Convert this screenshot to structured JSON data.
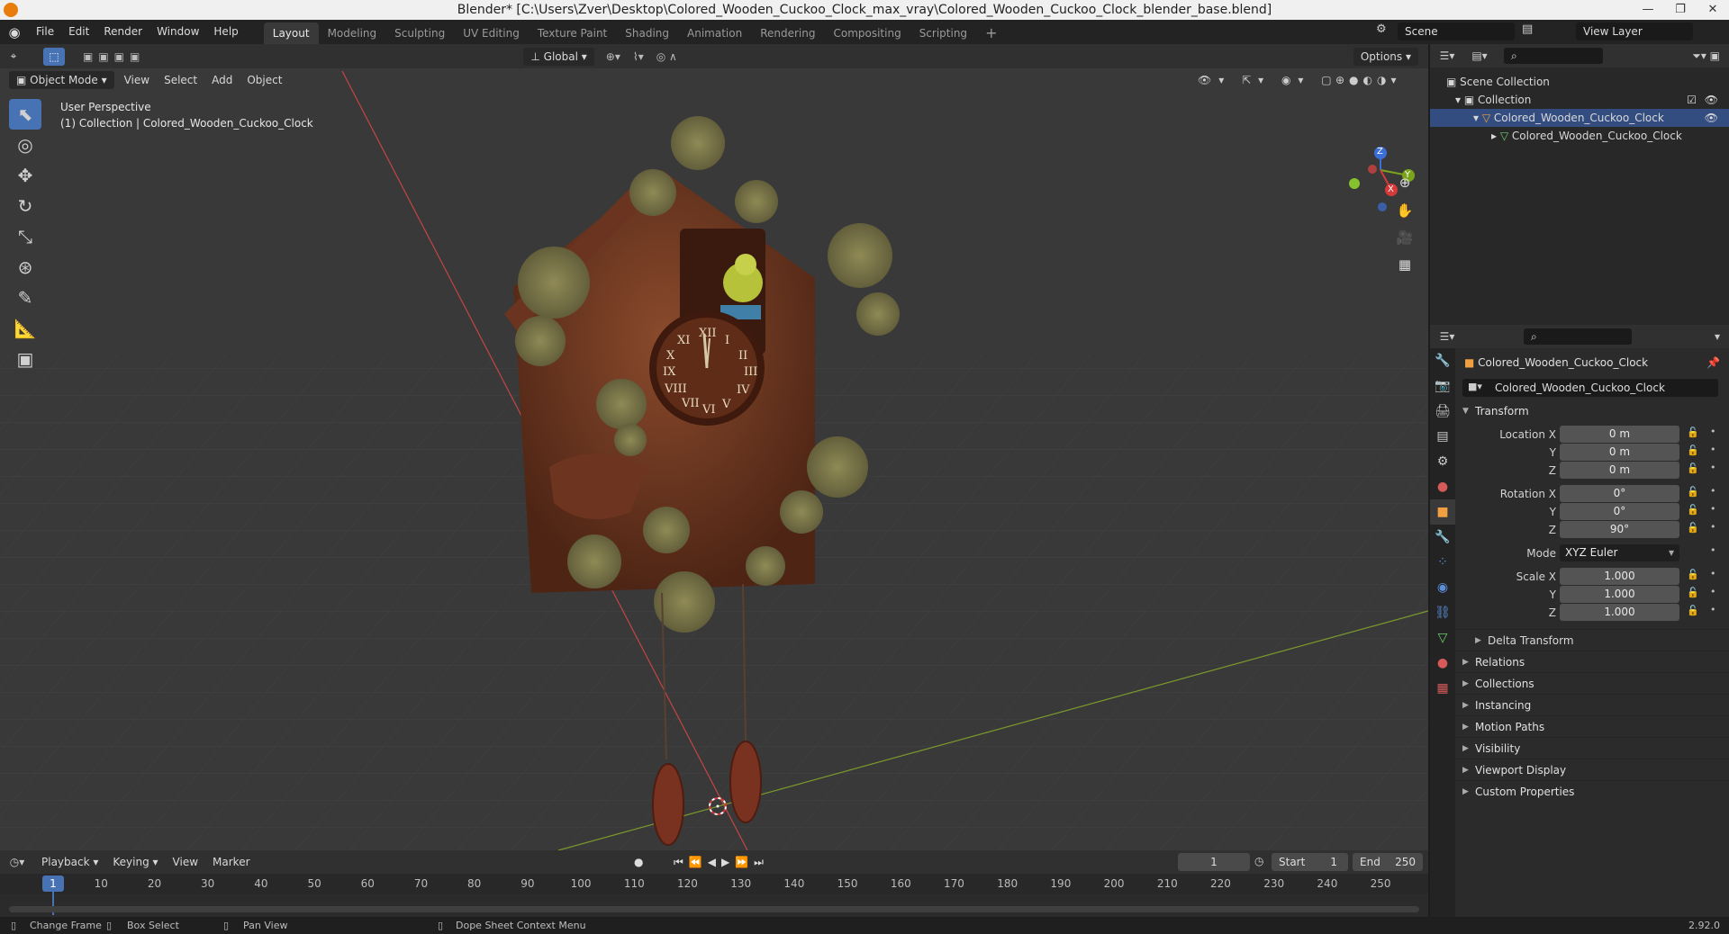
{
  "window": {
    "title": "Blender* [C:\\Users\\Zver\\Desktop\\Colored_Wooden_Cuckoo_Clock_max_vray\\Colored_Wooden_Cuckoo_Clock_blender_base.blend]",
    "minimize": "—",
    "restore": "❐",
    "close": "✕"
  },
  "menu": [
    "File",
    "Edit",
    "Render",
    "Window",
    "Help"
  ],
  "workspaces": [
    "Layout",
    "Modeling",
    "Sculpting",
    "UV Editing",
    "Texture Paint",
    "Shading",
    "Animation",
    "Rendering",
    "Compositing",
    "Scripting"
  ],
  "active_workspace": "Layout",
  "add_workspace": "+",
  "scene": {
    "label": "Scene",
    "view_layer": "View Layer"
  },
  "viewport": {
    "mode": "Object Mode",
    "menus": [
      "View",
      "Select",
      "Add",
      "Object"
    ],
    "orientation": "Global",
    "options": "Options",
    "perspective_label": "User Perspective",
    "collection_label": "(1) Collection | Colored_Wooden_Cuckoo_Clock",
    "axes": {
      "x": "X",
      "y": "Y",
      "z": "Z"
    },
    "accent": "#4772b3"
  },
  "outliner": {
    "root": "Scene Collection",
    "collection": "Collection",
    "object": "Colored_Wooden_Cuckoo_Clock",
    "mesh": "Colored_Wooden_Cuckoo_Clock"
  },
  "properties": {
    "object_name": "Colored_Wooden_Cuckoo_Clock",
    "object_field": "Colored_Wooden_Cuckoo_Clock",
    "transform": {
      "title": "Transform",
      "location_label": "Location X",
      "location": [
        "0 m",
        "0 m",
        "0 m"
      ],
      "rotation_label": "Rotation X",
      "rotation": [
        "0°",
        "0°",
        "90°"
      ],
      "mode_label": "Mode",
      "mode": "XYZ Euler",
      "scale_label": "Scale X",
      "scale": [
        "1.000",
        "1.000",
        "1.000"
      ],
      "y": "Y",
      "z": "Z"
    },
    "delta": "Delta Transform",
    "sections": [
      "Relations",
      "Collections",
      "Instancing",
      "Motion Paths",
      "Visibility",
      "Viewport Display",
      "Custom Properties"
    ]
  },
  "timeline": {
    "menus": [
      "Playback",
      "Keying",
      "View",
      "Marker"
    ],
    "current_frame": "1",
    "start_label": "Start",
    "start": "1",
    "end_label": "End",
    "end": "250",
    "ticks": [
      "1",
      "10",
      "20",
      "30",
      "40",
      "50",
      "60",
      "70",
      "80",
      "90",
      "100",
      "110",
      "120",
      "130",
      "140",
      "150",
      "160",
      "170",
      "180",
      "190",
      "200",
      "210",
      "220",
      "230",
      "240",
      "250"
    ]
  },
  "status": {
    "change_frame": "Change Frame",
    "box_select": "Box Select",
    "pan_view": "Pan View",
    "context_menu": "Dope Sheet Context Menu",
    "version": "2.92.0"
  }
}
